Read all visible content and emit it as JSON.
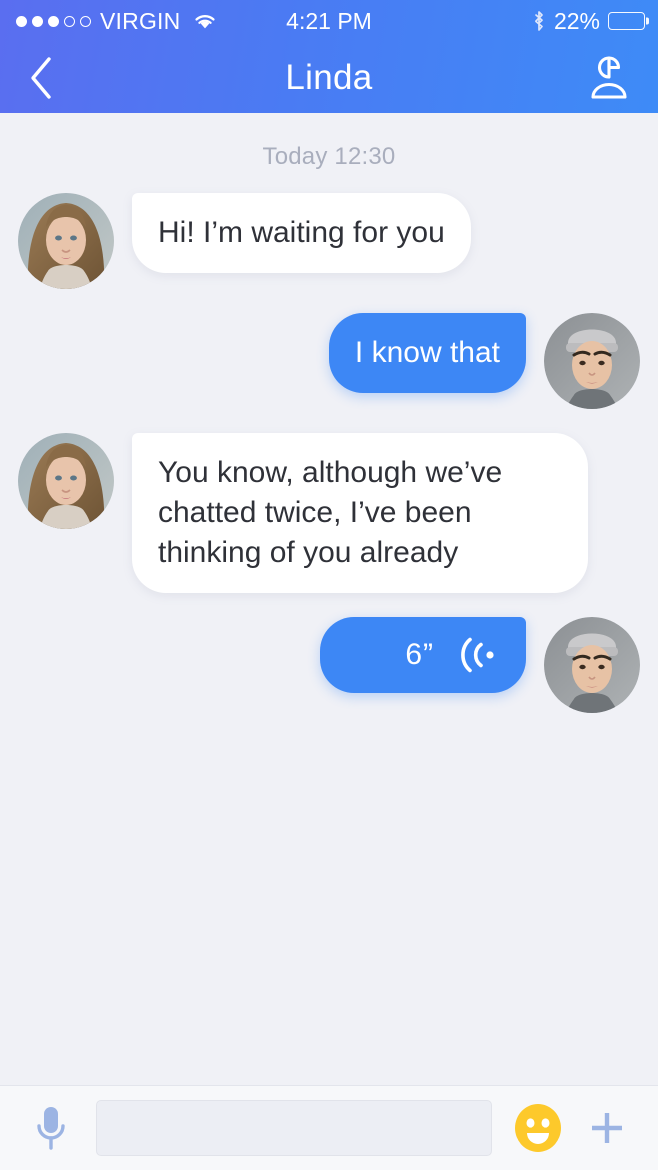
{
  "statusbar": {
    "carrier": "VIRGIN",
    "signal_dots_total": 5,
    "signal_dots_filled": 3,
    "wifi_icon": "wifi-icon",
    "time": "4:21 PM",
    "bluetooth_icon": "bluetooth-icon",
    "battery_percent": "22%",
    "battery_level": 22
  },
  "navbar": {
    "back_icon": "chevron-left-icon",
    "title": "Linda",
    "profile_icon": "contact-person-icon"
  },
  "chat": {
    "daystamp": "Today 12:30",
    "messages": [
      {
        "id": "msg-1",
        "direction": "in",
        "type": "text",
        "text": "Hi! I’m waiting for you",
        "avatar": "avatar-linda"
      },
      {
        "id": "msg-2",
        "direction": "out",
        "type": "text",
        "text": "I know that",
        "avatar": "avatar-me"
      },
      {
        "id": "msg-3",
        "direction": "in",
        "type": "text",
        "text": "You know, although we’ve chatted twice, I’ve been thinking of you already",
        "avatar": "avatar-linda"
      },
      {
        "id": "msg-4",
        "direction": "out",
        "type": "voice",
        "duration": "6”",
        "wave_icon": "sound-wave-icon",
        "avatar": "avatar-me"
      }
    ]
  },
  "composer": {
    "mic_icon": "microphone-icon",
    "input_value": "",
    "input_placeholder": "",
    "emoji_icon": "smiley-face-icon",
    "plus_icon": "plus-icon"
  },
  "colors": {
    "header_gradient_start": "#5a6ef0",
    "header_gradient_end": "#3e8bf7",
    "bubble_out": "#3d87f5",
    "bubble_in": "#ffffff",
    "chat_background": "#f0f1f6",
    "composer_background": "#f7f8fa",
    "accent_icon": "#9cb4e3",
    "emoji_yellow": "#fdc92b",
    "timestamp_text": "#a9aebd",
    "message_text": "#2f3138"
  }
}
